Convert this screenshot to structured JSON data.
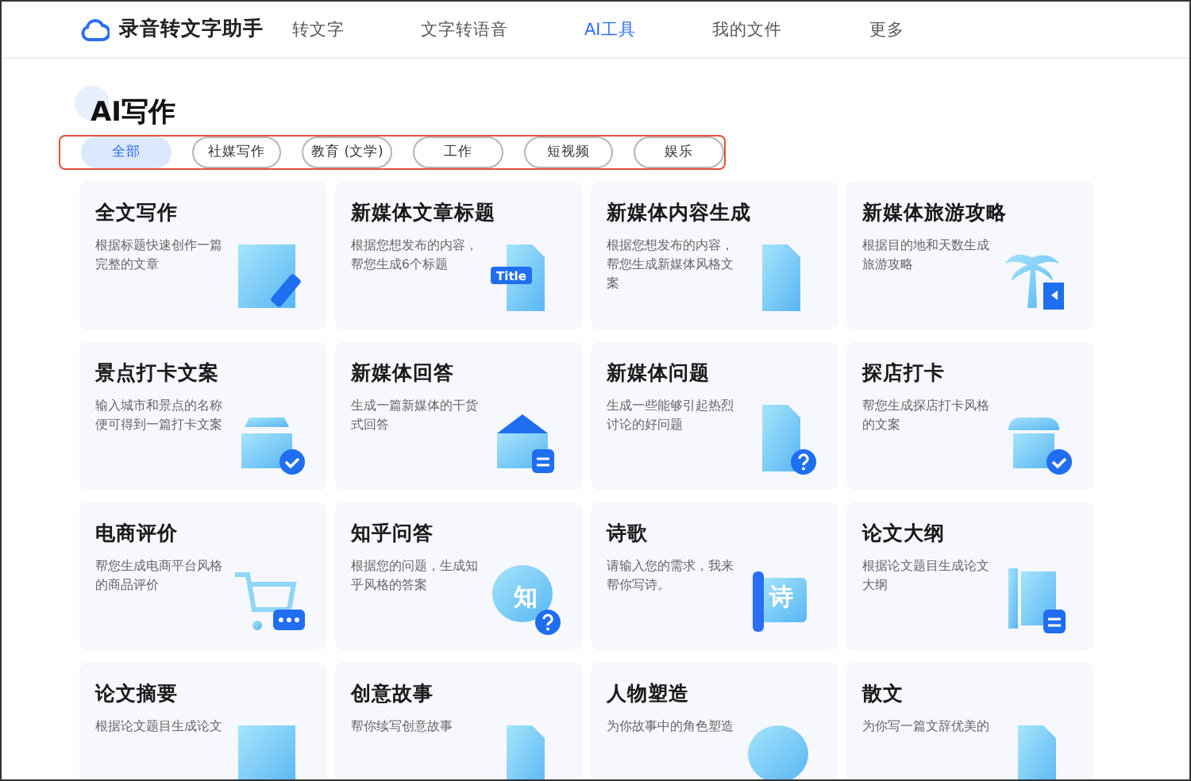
{
  "app": {
    "name": "录音转文字助手"
  },
  "nav": [
    {
      "label": "转文字",
      "selected": false
    },
    {
      "label": "文字转语音",
      "selected": false
    },
    {
      "label": "AI工具",
      "selected": true
    },
    {
      "label": "我的文件",
      "selected": false
    },
    {
      "label": "更多",
      "selected": false
    }
  ],
  "page_title": "AI写作",
  "categories": [
    {
      "label": "全部",
      "selected": true
    },
    {
      "label": "社媒写作",
      "selected": false
    },
    {
      "label": "教育 (文学)",
      "selected": false
    },
    {
      "label": "工作",
      "selected": false
    },
    {
      "label": "短视频",
      "selected": false
    },
    {
      "label": "娱乐",
      "selected": false
    }
  ],
  "cards": [
    {
      "title": "全文写作",
      "description": "根据标题快速创作一篇完整的文章",
      "kind": "book-pen"
    },
    {
      "title": "新媒体文章标题",
      "description": "根据您想发布的内容，帮您生成6个标题",
      "kind": "doc-title",
      "icon_text": "Title"
    },
    {
      "title": "新媒体内容生成",
      "description": "根据您想发布的内容，帮您生成新媒体风格文案",
      "kind": "doc"
    },
    {
      "title": "新媒体旅游攻略",
      "description": "根据目的地和天数生成旅游攻略",
      "kind": "palm-flag"
    },
    {
      "title": "景点打卡文案",
      "description": "输入城市和景点的名称便可得到一篇打卡文案",
      "kind": "gate-check"
    },
    {
      "title": "新媒体回答",
      "description": "生成一篇新媒体的干货式回答",
      "kind": "house-lines"
    },
    {
      "title": "新媒体问题",
      "description": "生成一些能够引起热烈讨论的好问题",
      "kind": "doc-question"
    },
    {
      "title": "探店打卡",
      "description": "帮您生成探店打卡风格的文案",
      "kind": "shop-check"
    },
    {
      "title": "电商评价",
      "description": "帮您生成电商平台风格的商品评价",
      "kind": "cart-chat"
    },
    {
      "title": "知乎问答",
      "description": "根据您的问题，生成知乎风格的答案",
      "kind": "bubble-question",
      "icon_text": "知"
    },
    {
      "title": "诗歌",
      "description": "请输入您的需求，我来帮你写诗。",
      "kind": "scroll",
      "icon_text": "诗"
    },
    {
      "title": "论文大纲",
      "description": "根据论文题目生成论文大纲",
      "kind": "outline-lines"
    },
    {
      "title": "论文摘要",
      "description": "根据论文题目生成论文",
      "kind": "book"
    },
    {
      "title": "创意故事",
      "description": "帮你续写创意故事",
      "kind": "doc"
    },
    {
      "title": "人物塑造",
      "description": "为你故事中的角色塑造",
      "kind": "bubble"
    },
    {
      "title": "散文",
      "description": "为你写一篇文辞优美的",
      "kind": "doc"
    }
  ]
}
